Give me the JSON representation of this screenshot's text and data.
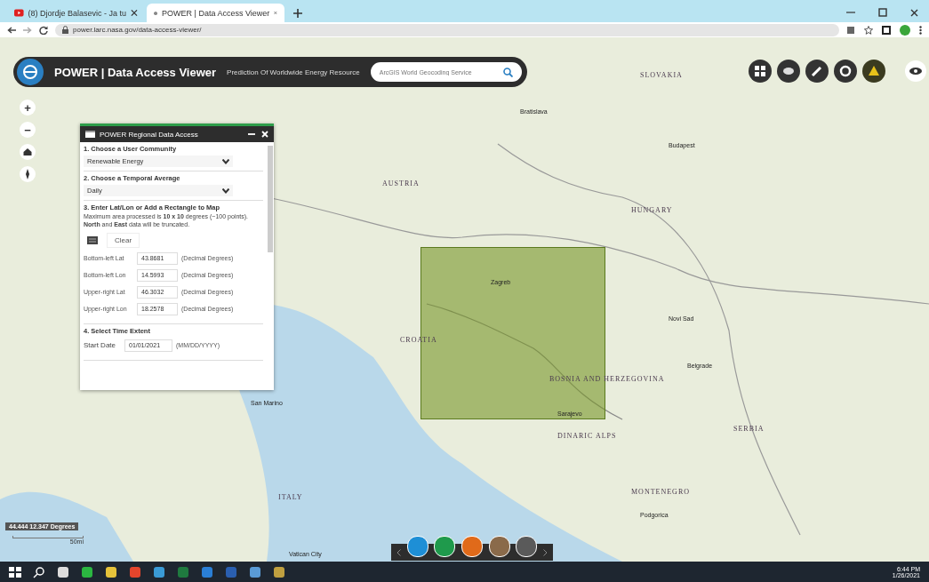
{
  "browser": {
    "tabs": [
      {
        "title": "(8) Djordje Balasevic - Ja tu",
        "selected": false
      },
      {
        "title": "POWER | Data Access Viewer",
        "selected": true
      }
    ],
    "url": "power.larc.nasa.gov/data-access-viewer/"
  },
  "app_header": {
    "title": "POWER | Data Access Viewer",
    "subtitle": "Prediction Of Worldwide Energy Resource",
    "search": {
      "placeholder": "ArcGIS World Geocoding Service"
    }
  },
  "map_controls": [
    "+",
    "−"
  ],
  "map_labels": [
    {
      "text": "SLOVAKIA",
      "kind": "country"
    },
    {
      "text": "Bratislava",
      "kind": "city"
    },
    {
      "text": "Budapest",
      "kind": "city"
    },
    {
      "text": "AUSTRIA",
      "kind": "country"
    },
    {
      "text": "HUNGARY",
      "kind": "country"
    },
    {
      "text": "Zagreb",
      "kind": "city"
    },
    {
      "text": "Novi Sad",
      "kind": "city"
    },
    {
      "text": "CROATIA",
      "kind": "country"
    },
    {
      "text": "Belgrade",
      "kind": "city"
    },
    {
      "text": "BOSNIA AND HERZEGOVINA",
      "kind": "country"
    },
    {
      "text": "San Marino",
      "kind": "city"
    },
    {
      "text": "Sarajevo",
      "kind": "city"
    },
    {
      "text": "SERBIA",
      "kind": "country"
    },
    {
      "text": "DINARIC ALPS",
      "kind": "country"
    },
    {
      "text": "MONTENEGRO",
      "kind": "country"
    },
    {
      "text": "ITALY",
      "kind": "country"
    },
    {
      "text": "Podgorica",
      "kind": "city"
    },
    {
      "text": "Vatican City",
      "kind": "city"
    }
  ],
  "panel": {
    "title": "POWER Regional Data Access",
    "sections": [
      {
        "heading": "1. Choose a User Community",
        "kind": "select",
        "value": "Renewable Energy"
      },
      {
        "heading": "2. Choose a Temporal Average",
        "kind": "select",
        "value": "Daily"
      },
      {
        "heading": "3. Enter Lat/Lon or Add a Rectangle to Map",
        "kind": "coords",
        "note": "Maximum area processed is **10 x 10** degrees (~100 points). **North** and **East** data will be truncated.",
        "button": "Clear",
        "fields": [
          {
            "label": "Bottom-left Lat",
            "value": "43.8681",
            "unit": "(Decimal Degrees)"
          },
          {
            "label": "Bottom-left Lon",
            "value": "14.5993",
            "unit": "(Decimal Degrees)"
          },
          {
            "label": "Upper-right Lat",
            "value": "46.3032",
            "unit": "(Decimal Degrees)"
          },
          {
            "label": "Upper-right Lon",
            "value": "18.2578",
            "unit": "(Decimal Degrees)"
          }
        ]
      },
      {
        "heading": "4. Select Time Extent",
        "kind": "date",
        "label": "Start Date",
        "value": "01/01/2021",
        "hint": "(MM/DD/YYYY)"
      }
    ]
  },
  "coordinates": "44.444 12.347 Degrees",
  "scale": "50mi",
  "tool_buttons": [
    {
      "color": "#1e8fd6"
    },
    {
      "color": "#1f9a4c"
    },
    {
      "color": "#e06a1a"
    },
    {
      "color": "#8a6a4a"
    },
    {
      "color": "#5a5a5a"
    }
  ],
  "taskbar": {
    "time": "6:44 PM",
    "date": "1/26/2021"
  }
}
